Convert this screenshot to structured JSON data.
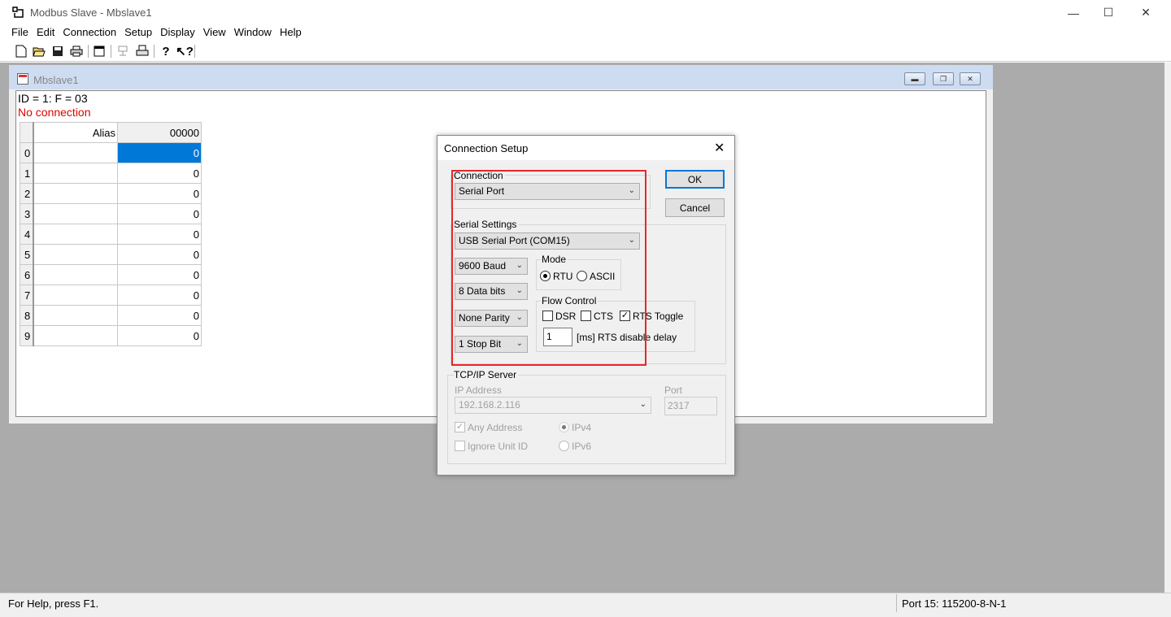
{
  "app": {
    "title": "Modbus Slave - Mbslave1"
  },
  "menu": [
    "File",
    "Edit",
    "Connection",
    "Setup",
    "Display",
    "View",
    "Window",
    "Help"
  ],
  "toolbar": [
    "new-icon",
    "open-icon",
    "save-icon",
    "print-icon",
    "window-icon",
    "connect-icon",
    "print-preview-icon",
    "help-icon",
    "context-help-icon"
  ],
  "child": {
    "title": "Mbslave1",
    "id_line": "ID = 1: F = 03",
    "status": "No connection",
    "table": {
      "alias_header": "Alias",
      "value_header": "00000",
      "rows": [
        {
          "idx": "0",
          "val": "0"
        },
        {
          "idx": "1",
          "val": "0"
        },
        {
          "idx": "2",
          "val": "0"
        },
        {
          "idx": "3",
          "val": "0"
        },
        {
          "idx": "4",
          "val": "0"
        },
        {
          "idx": "5",
          "val": "0"
        },
        {
          "idx": "6",
          "val": "0"
        },
        {
          "idx": "7",
          "val": "0"
        },
        {
          "idx": "8",
          "val": "0"
        },
        {
          "idx": "9",
          "val": "0"
        }
      ]
    }
  },
  "dialog": {
    "title": "Connection Setup",
    "connection_label": "Connection",
    "connection_value": "Serial Port",
    "ok": "OK",
    "cancel": "Cancel",
    "serial_label": "Serial Settings",
    "port_value": "USB Serial Port (COM15)",
    "baud": "9600 Baud",
    "databits": "8 Data bits",
    "parity": "None Parity",
    "stopbits": "1 Stop Bit",
    "mode_label": "Mode",
    "rtu": "RTU",
    "ascii": "ASCII",
    "flow_label": "Flow Control",
    "dsr": "DSR",
    "cts": "CTS",
    "rts_toggle": "RTS Toggle",
    "rts_delay_value": "1",
    "rts_delay_label": "[ms] RTS disable delay",
    "tcp_label": "TCP/IP Server",
    "ip_label": "IP Address",
    "ip_value": "192.168.2.116",
    "port_label": "Port",
    "port_num": "2317",
    "any_address": "Any Address",
    "ignore_unit": "Ignore Unit ID",
    "ipv4": "IPv4",
    "ipv6": "IPv6"
  },
  "status": {
    "left": "For Help, press F1.",
    "right": "Port 15: 115200-8-N-1"
  }
}
